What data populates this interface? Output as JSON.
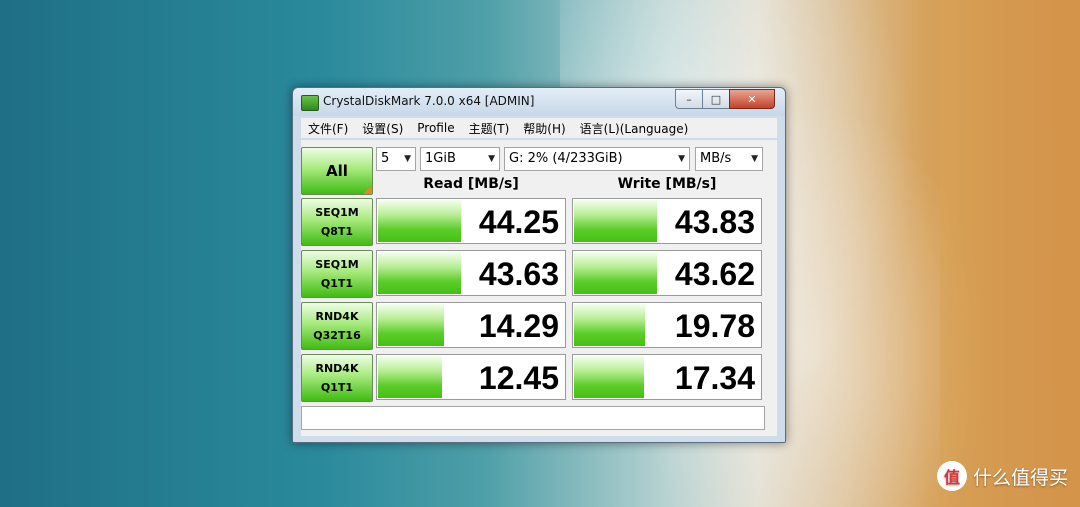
{
  "window": {
    "title": "CrystalDiskMark 7.0.0 x64 [ADMIN]"
  },
  "titlebar_buttons": {
    "minimize": "–",
    "maximize": "□",
    "close": "✕"
  },
  "menu": [
    "文件(F)",
    "设置(S)",
    "Profile",
    "主题(T)",
    "帮助(H)",
    "语言(L)(Language)"
  ],
  "controls": {
    "all_button": "All",
    "count": "5",
    "size": "1GiB",
    "drive": "G: 2% (4/233GiB)",
    "unit": "MB/s"
  },
  "headers": {
    "read": "Read [MB/s]",
    "write": "Write [MB/s]"
  },
  "tests": [
    {
      "line1": "SEQ1M",
      "line2": "Q8T1",
      "read": "44.25",
      "write": "43.83",
      "read_level": 0.44,
      "write_level": 0.44
    },
    {
      "line1": "SEQ1M",
      "line2": "Q1T1",
      "read": "43.63",
      "write": "43.62",
      "read_level": 0.44,
      "write_level": 0.44
    },
    {
      "line1": "RND4K",
      "line2": "Q32T16",
      "read": "14.29",
      "write": "19.78",
      "read_level": 0.35,
      "write_level": 0.38
    },
    {
      "line1": "RND4K",
      "line2": "Q1T1",
      "read": "12.45",
      "write": "17.34",
      "read_level": 0.34,
      "write_level": 0.37
    }
  ],
  "watermark": {
    "logo": "值",
    "text": "什么值得买"
  },
  "colors": {
    "bar_green": "#43c112",
    "accent_orange": "#e28a1e"
  }
}
